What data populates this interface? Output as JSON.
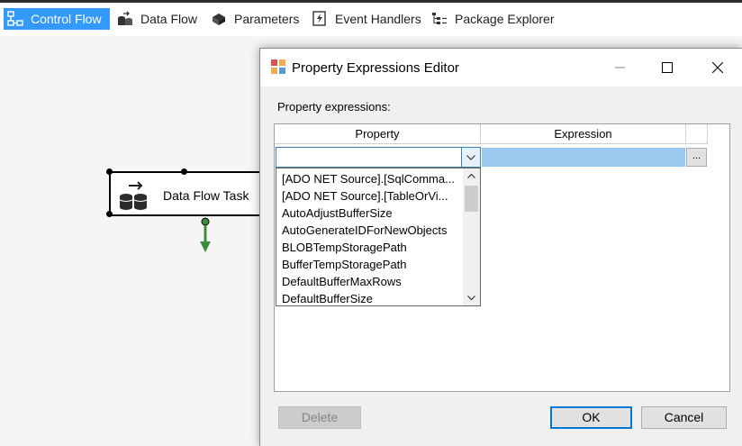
{
  "tabs": [
    {
      "label": "Control Flow",
      "icon": "control-flow-icon",
      "active": true
    },
    {
      "label": "Data Flow",
      "icon": "data-flow-icon",
      "active": false
    },
    {
      "label": "Parameters",
      "icon": "parameters-icon",
      "active": false
    },
    {
      "label": "Event Handlers",
      "icon": "event-handlers-icon",
      "active": false
    },
    {
      "label": "Package Explorer",
      "icon": "package-explorer-icon",
      "active": false
    }
  ],
  "canvas": {
    "task_label": "Data Flow Task"
  },
  "dialog": {
    "title": "Property Expressions Editor",
    "section_label": "Property expressions:",
    "columns": {
      "property": "Property",
      "expression": "Expression"
    },
    "ellipsis": "...",
    "property_value": "",
    "dropdown_items": [
      "[ADO NET Source].[SqlComma...",
      "[ADO NET Source].[TableOrVi...",
      "AutoAdjustBufferSize",
      "AutoGenerateIDForNewObjects",
      "BLOBTempStoragePath",
      "BufferTempStoragePath",
      "DefaultBufferMaxRows",
      "DefaultBufferSize"
    ],
    "buttons": {
      "delete": "Delete",
      "ok": "OK",
      "cancel": "Cancel"
    }
  },
  "colors": {
    "accent": "#3399ff",
    "selection": "#99c9ef",
    "success_arrow": "#3a8e3a"
  }
}
